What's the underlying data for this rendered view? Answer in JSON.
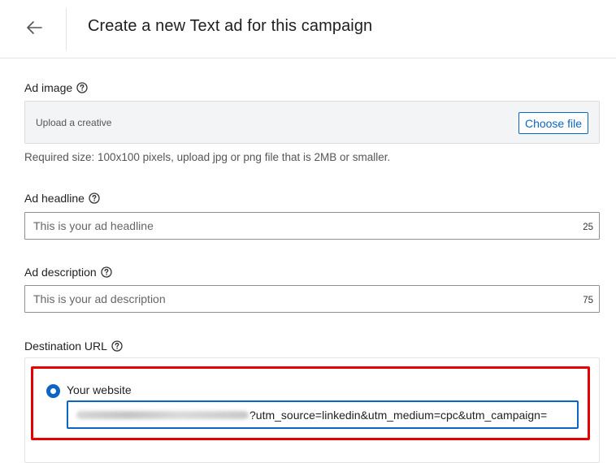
{
  "header": {
    "title": "Create a new Text ad for this campaign",
    "back_icon": "arrow-left-icon"
  },
  "ad_image": {
    "label": "Ad image",
    "upload_placeholder": "Upload a creative",
    "choose_file_label": "Choose file",
    "helper": "Required size: 100x100 pixels, upload jpg or png file that is 2MB or smaller."
  },
  "ad_headline": {
    "label": "Ad headline",
    "placeholder": "This is your ad headline",
    "value": "",
    "counter": "25"
  },
  "ad_description": {
    "label": "Ad description",
    "placeholder": "This is your ad description",
    "value": "",
    "counter": "75"
  },
  "destination_url": {
    "label": "Destination URL",
    "option_label": "Your website",
    "option_selected": true,
    "url_visible_part": "?utm_source=linkedin&utm_medium=cpc&utm_campaign="
  },
  "colors": {
    "accent": "#0a66c2",
    "highlight": "#e60000",
    "border": "#8f8f8f"
  }
}
